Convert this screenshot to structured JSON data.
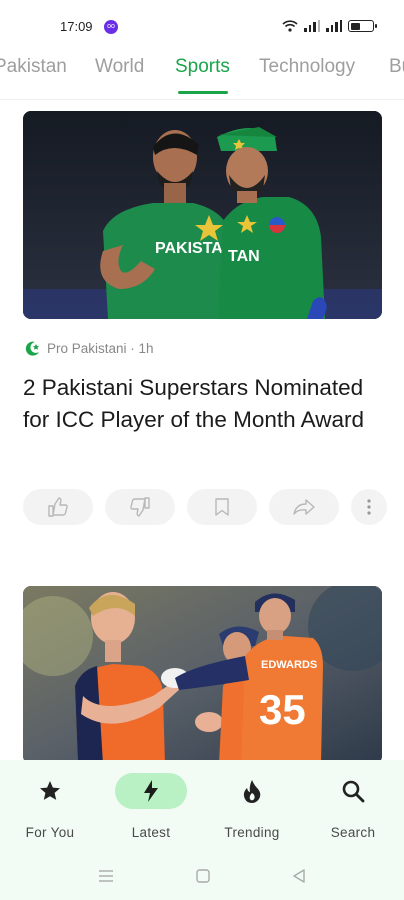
{
  "status_bar": {
    "time": "17:09",
    "badge": "oo"
  },
  "tabs": [
    {
      "label": "Pakistan",
      "active": false
    },
    {
      "label": "World",
      "active": false
    },
    {
      "label": "Sports",
      "active": true
    },
    {
      "label": "Technology",
      "active": false
    },
    {
      "label": "Business",
      "active": false
    }
  ],
  "article": {
    "source": "Pro Pakistani · 1h",
    "headline": "2 Pakistani Superstars Nominated for ICC Player of the Month Award",
    "image_text": {
      "jersey_left": "PAKISTAN",
      "jersey_right": "TAN"
    },
    "actions": [
      "thumbs-up-icon",
      "thumbs-down-icon",
      "bookmark-icon",
      "share-icon",
      "more-icon"
    ]
  },
  "article2": {
    "image_text": {
      "name": "EDWARDS",
      "number": "35"
    }
  },
  "bottom_nav": [
    {
      "label": "For You",
      "icon": "star-icon",
      "active": false
    },
    {
      "label": "Latest",
      "icon": "lightning-icon",
      "active": true
    },
    {
      "label": "Trending",
      "icon": "flame-icon",
      "active": false
    },
    {
      "label": "Search",
      "icon": "search-icon",
      "active": false
    }
  ],
  "colors": {
    "accent": "#1aa54a",
    "nav_bg": "#f2fbf4",
    "active_pill": "#b9f0c4"
  }
}
